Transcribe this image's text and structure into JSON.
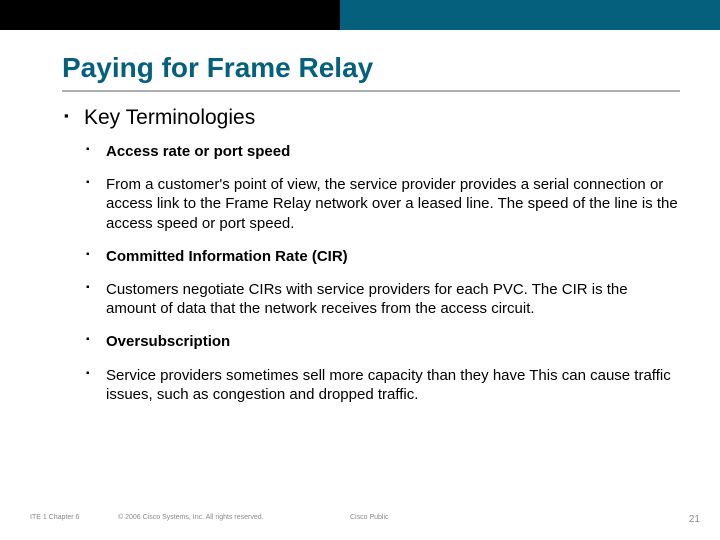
{
  "header": {
    "title": "Paying for Frame Relay"
  },
  "main": {
    "subtitle": "Key Terminologies",
    "items": [
      {
        "bold": true,
        "text": "Access rate or port speed"
      },
      {
        "bold": false,
        "text": "From a customer's point of view, the service provider provides a serial connection or access link to the Frame Relay network over a leased line. The speed of the line is the access speed or port speed."
      },
      {
        "bold": true,
        "text": "Committed Information Rate (CIR)"
      },
      {
        "bold": false,
        "text": " Customers negotiate CIRs with service providers for each PVC. The CIR is the amount of data that the network receives from the access circuit."
      },
      {
        "bold": true,
        "text": "Oversubscription"
      },
      {
        "bold": false,
        "text": "Service providers sometimes sell more capacity than they have This can cause traffic issues, such as congestion and dropped traffic."
      }
    ]
  },
  "footer": {
    "left1": "ITE 1 Chapter 6",
    "left2": "© 2006 Cisco Systems, Inc. All rights reserved.",
    "left3": "Cisco Public",
    "page": "21"
  }
}
